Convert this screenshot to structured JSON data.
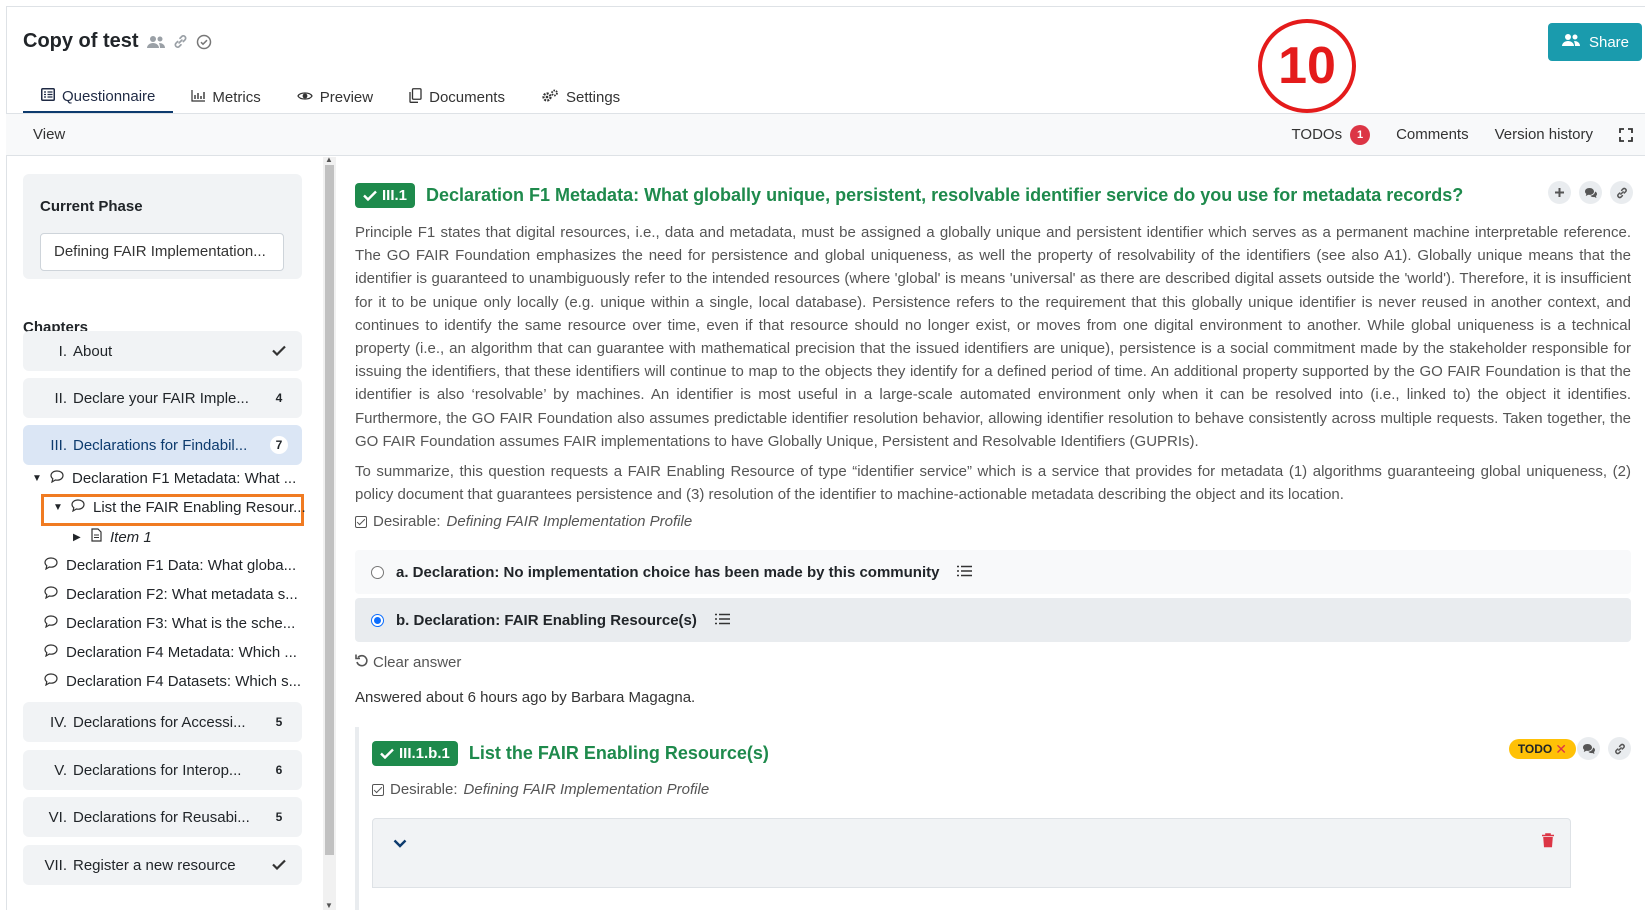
{
  "header": {
    "title": "Copy of test",
    "share_label": "Share",
    "annotation_number": "10",
    "brand_color": "#1a9bad"
  },
  "tabs": [
    {
      "label": "Questionnaire",
      "icon": "list-icon",
      "active": true
    },
    {
      "label": "Metrics",
      "icon": "chart-icon"
    },
    {
      "label": "Preview",
      "icon": "eye-icon"
    },
    {
      "label": "Documents",
      "icon": "copy-icon"
    },
    {
      "label": "Settings",
      "icon": "gears-icon"
    }
  ],
  "toolbar": {
    "view_label": "View",
    "todos_label": "TODOs",
    "todos_count": "1",
    "comments_label": "Comments",
    "version_history_label": "Version history"
  },
  "sidebar": {
    "phase_label": "Current Phase",
    "phase_value": "Defining FAIR Implementation...",
    "chapters_label": "Chapters",
    "chapters": [
      {
        "num": "I.",
        "name": "About",
        "status": "done"
      },
      {
        "num": "II.",
        "name": "Declare your FAIR Imple...",
        "count": "4"
      },
      {
        "num": "III.",
        "name": "Declarations for Findabil...",
        "count": "7",
        "active": true
      },
      {
        "num": "IV.",
        "name": "Declarations for Accessi...",
        "count": "5"
      },
      {
        "num": "V.",
        "name": "Declarations for Interop...",
        "count": "6"
      },
      {
        "num": "VI.",
        "name": "Declarations for Reusabi...",
        "count": "5"
      },
      {
        "num": "VII.",
        "name": "Register a new resource",
        "status": "done"
      }
    ],
    "tree": [
      {
        "label": "Declaration F1 Metadata: What ..."
      },
      {
        "label": "List the FAIR Enabling Resour..."
      },
      {
        "label": "Item 1"
      },
      {
        "label": "Declaration F1 Data: What globa..."
      },
      {
        "label": "Declaration F2: What metadata s..."
      },
      {
        "label": "Declaration F3: What is the sche..."
      },
      {
        "label": "Declaration F4 Metadata: Which ..."
      },
      {
        "label": "Declaration F4 Datasets: Which s..."
      }
    ]
  },
  "question": {
    "number": "III.1",
    "title": "Declaration F1 Metadata: What globally unique, persistent, resolvable identifier service do you use for metadata records?",
    "description": "Principle F1 states that digital resources, i.e., data and metadata, must be assigned a globally unique and persistent identifier which serves as a permanent machine interpretable reference. The GO FAIR Foundation emphasizes the need for persistence and global uniqueness, as well the property of resolvability of the identifiers (see also A1). Globally unique means that the identifier is guaranteed to unambiguously refer to the intended resources (where 'global' is means 'universal' as there are described digital assets outside the 'world'). Therefore, it is insufficient for it to be unique only locally (e.g. unique within a single, local database). Persistence refers to the requirement that this globally unique identifier is never reused in another context, and continues to identify the same resource over time, even if that resource should no longer exist, or moves from one digital environment to another. While global uniqueness is a technical property (i.e., an algorithm that can guarantee with mathematical precision that the issued identifiers are unique), persistence is a social commitment made by the stakeholder responsible for issuing the identifiers, that these identifiers will continue to map to the objects they identify for a defined period of time. An additional property supported by the GO FAIR Foundation is that the identifier is also ‘resolvable’ by machines. An identifier is most useful in a large-scale automated environment only when it can be resolved into (i.e., linked to) the object it identifies. Furthermore, the GO FAIR Foundation also assumes predictable identifier resolution behavior, allowing identifier resolution to behave consistently across multiple requests. Taken together, the GO FAIR Foundation assumes FAIR implementations to have Globally Unique, Persistent and Resolvable Identifiers (GUPRIs).",
    "summary": "To summarize, this question requests a FAIR Enabling Resource of type “identifier service” which is a service that provides for metadata (1) algorithms guaranteeing global uniqueness, (2) policy document that guarantees persistence and (3) resolution of the identifier to machine-actionable metadata describing the object and its location.",
    "desirable_label": "Desirable:",
    "desirable_phase": "Defining FAIR Implementation Profile",
    "options": [
      {
        "label": "a. Declaration: No implementation choice has been made by this community",
        "selected": false
      },
      {
        "label": "b. Declaration: FAIR Enabling Resource(s)",
        "selected": true
      }
    ],
    "clear_answer_label": "Clear answer",
    "answered_text": "Answered about 6 hours ago by Barbara Magagna."
  },
  "followup": {
    "number": "III.1.b.1",
    "title": "List the FAIR Enabling Resource(s)",
    "todo_label": "TODO",
    "desirable_label": "Desirable:",
    "desirable_phase": "Defining FAIR Implementation Profile"
  },
  "colors": {
    "accent_green": "#1e8a4c",
    "todo_yellow": "#ffc107",
    "danger": "#dc3545",
    "highlight_orange": "#f07b22"
  }
}
